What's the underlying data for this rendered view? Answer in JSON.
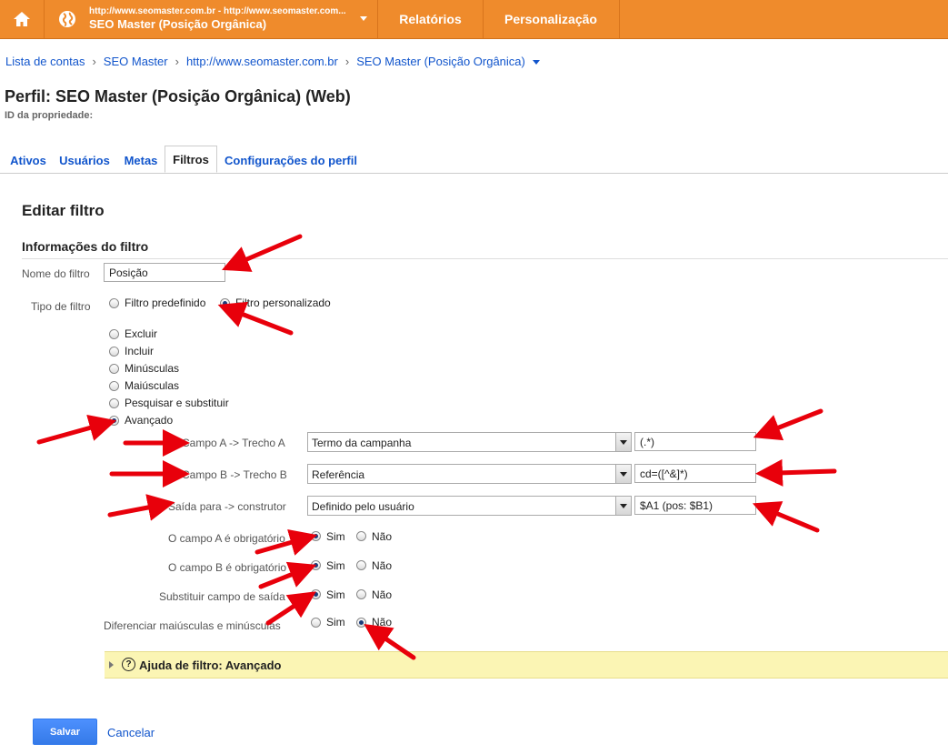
{
  "topbar": {
    "account_url": "http://www.seomaster.com.br - http://www.seomaster.com...",
    "account_name": "SEO Master (Posição Orgânica)",
    "nav_reports": "Relatórios",
    "nav_custom": "Personalização",
    "icons": [
      "home-icon",
      "globe-icon",
      "chevron-down-icon"
    ]
  },
  "breadcrumb": [
    "Lista de contas",
    "SEO Master",
    "http://www.seomaster.com.br",
    "SEO Master (Posição Orgânica)"
  ],
  "breadcrumb_separator": "›",
  "profile": {
    "title": "Perfil: SEO Master (Posição Orgânica) (Web)",
    "property_id_label": "ID da propriedade:"
  },
  "tabs": [
    "Ativos",
    "Usuários",
    "Metas",
    "Filtros",
    "Configurações do perfil"
  ],
  "active_tab": "Filtros",
  "form": {
    "heading": "Editar filtro",
    "section": "Informações do filtro",
    "name_label": "Nome do filtro",
    "name_value": "Posição",
    "type_label": "Tipo de filtro",
    "type_predefined": "Filtro predefinido",
    "type_custom": "Filtro personalizado",
    "options": [
      "Excluir",
      "Incluir",
      "Minúsculas",
      "Maiúsculas",
      "Pesquisar e substituir",
      "Avançado"
    ],
    "selected_option": "Avançado",
    "field_a_label": "Campo A -> Trecho A",
    "field_a_select": "Termo da campanha",
    "field_a_value": "(.*)",
    "field_b_label": "Campo B -> Trecho B",
    "field_b_select": "Referência",
    "field_b_value": "cd=([^&]*)",
    "output_label": "Saída para -> construtor",
    "output_select": "Definido pelo usuário",
    "output_value": "$A1 (pos: $B1)",
    "req_a_label": "O campo A é obrigatório",
    "req_b_label": "O campo B é obrigatório",
    "override_label": "Substituir campo de saída",
    "case_label": "Diferenciar maiúsculas e minúsculas",
    "yes": "Sim",
    "no": "Não",
    "help_title": "Ajuda de filtro: Avançado",
    "save": "Salvar",
    "cancel": "Cancelar"
  },
  "colors": {
    "topbar": "#ef8b2c",
    "link": "#1155cc",
    "help_bg": "#fbf5b4",
    "save_button": "#4d90fe",
    "annotation_arrow": "#e8000b"
  }
}
